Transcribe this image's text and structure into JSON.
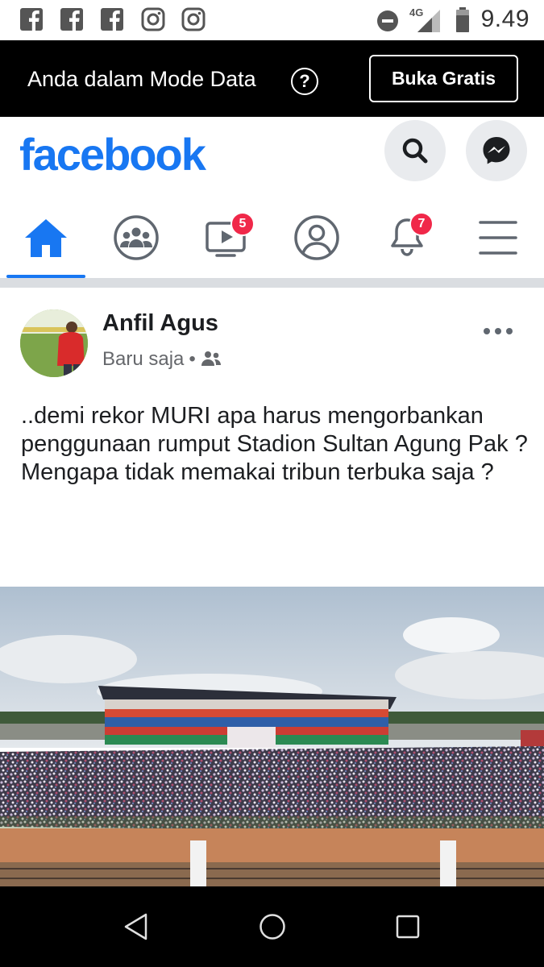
{
  "status_bar": {
    "time": "9.49",
    "network": "4G",
    "notification_icons": [
      "facebook-icon",
      "facebook-icon",
      "facebook-icon",
      "instagram-icon",
      "instagram-icon"
    ]
  },
  "data_mode": {
    "message": "Anda dalam Mode Data",
    "help": "?",
    "button_label": "Buka Gratis"
  },
  "header": {
    "logo": "facebook"
  },
  "nav": {
    "tabs": [
      {
        "name": "home",
        "badge": ""
      },
      {
        "name": "groups",
        "badge": ""
      },
      {
        "name": "watch",
        "badge": "5"
      },
      {
        "name": "profile",
        "badge": ""
      },
      {
        "name": "notifications",
        "badge": "7"
      },
      {
        "name": "menu",
        "badge": ""
      }
    ],
    "active": "home"
  },
  "post": {
    "author": "Anfil Agus",
    "time": "Baru saja",
    "separator": "•",
    "audience_icon": "friends-icon",
    "text_lines": [
      "..demi rekor MURI apa harus mengorbankan penggunaan rumput Stadion Sultan Agung Pak ?",
      "Mengapa tidak memakai tribun terbuka saja ?"
    ]
  },
  "colors": {
    "brand": "#1877f2",
    "badge": "#f02849",
    "data_bar": "#000000"
  }
}
